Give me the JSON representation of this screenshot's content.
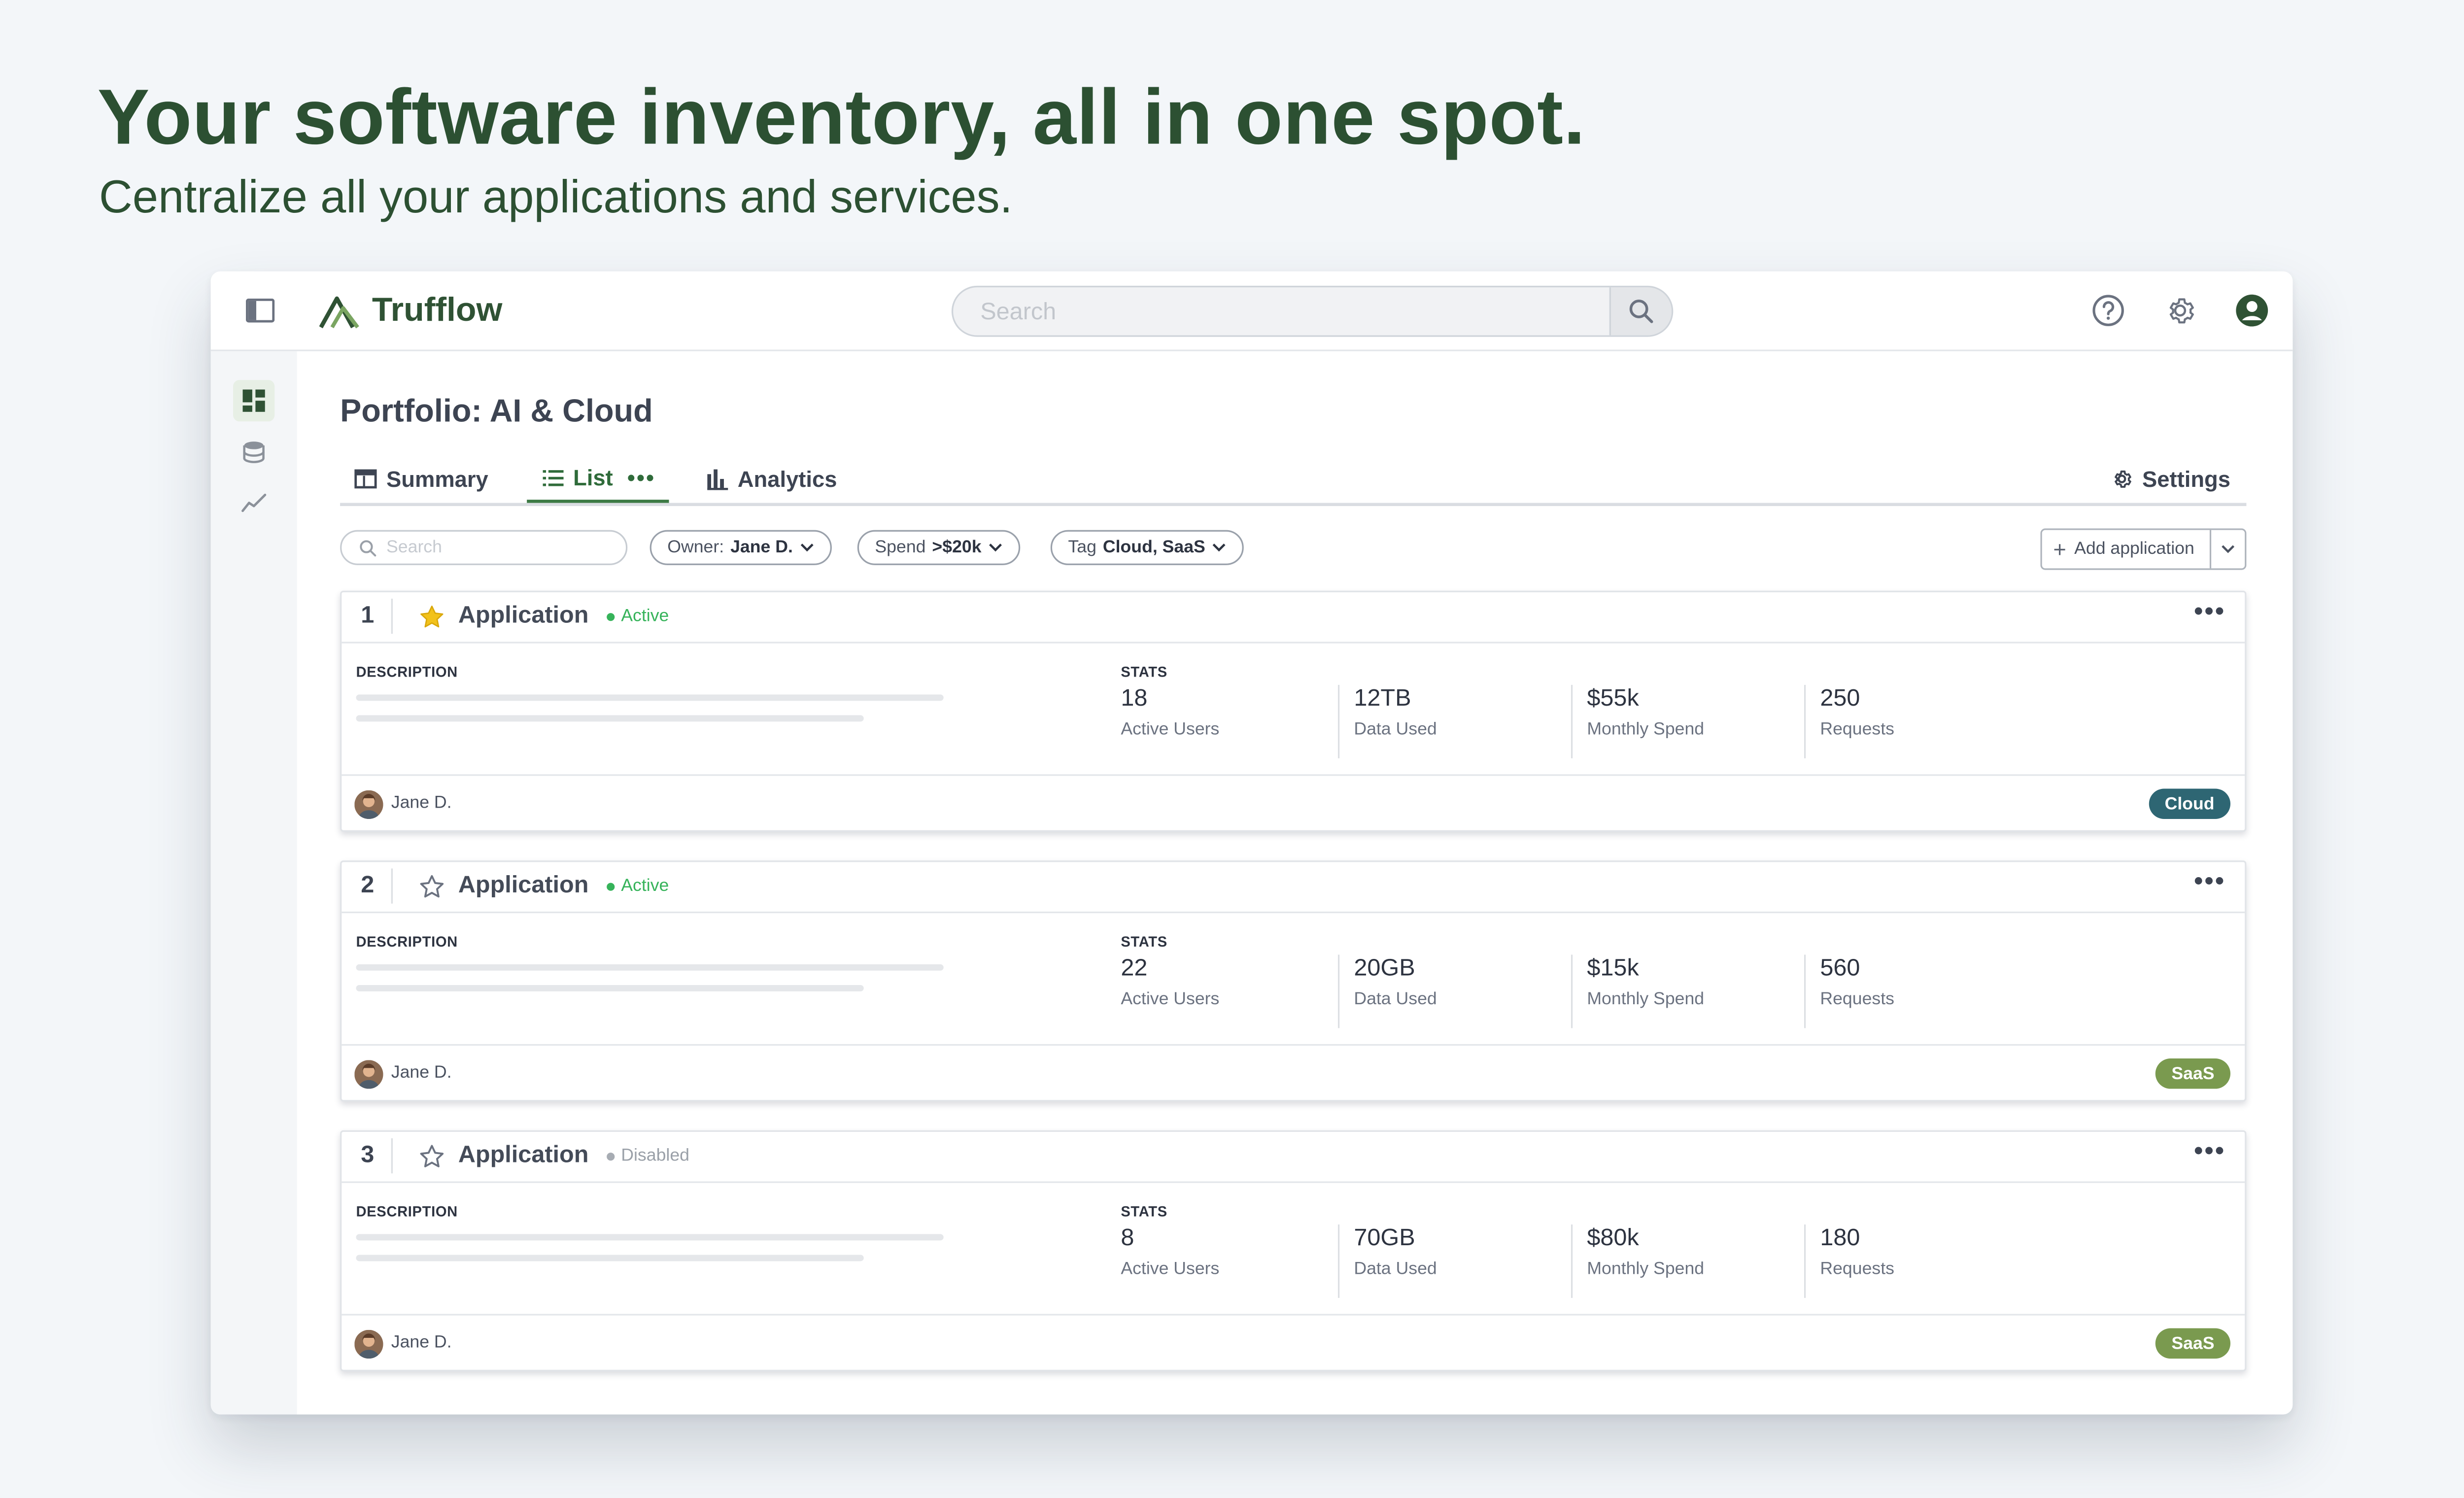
{
  "hero": {
    "title": "Your software inventory, all in one spot.",
    "subtitle": "Centralize all your applications and services."
  },
  "app": {
    "name": "Trufflow",
    "search_placeholder": "Search"
  },
  "icons": {
    "sidebar_toggle": "sidebar-toggle-icon",
    "search": "search-icon",
    "help": "help-icon",
    "settings": "gear-icon",
    "account": "user-circle-icon",
    "rail": [
      "dashboard-icon",
      "database-icon",
      "trend-chart-icon"
    ]
  },
  "page": {
    "title": "Portfolio: AI & Cloud",
    "tabs": [
      {
        "label": "Summary",
        "icon": "table-icon",
        "active": false
      },
      {
        "label": "List",
        "icon": "list-icon",
        "active": true,
        "more": "•••"
      },
      {
        "label": "Analytics",
        "icon": "bar-chart-icon",
        "active": false
      }
    ],
    "settings_label": "Settings"
  },
  "filters": {
    "search_placeholder": "Search",
    "owner": {
      "label": "Owner:",
      "value": "Jane D."
    },
    "spend": {
      "label": "Spend",
      "value": ">$20k"
    },
    "tag": {
      "label": "Tag",
      "value": "Cloud, SaaS"
    },
    "add_button": "Add application"
  },
  "labels": {
    "description": "DESCRIPTION",
    "stats": "STATS"
  },
  "cards": [
    {
      "number": "1",
      "starred": true,
      "title": "Application",
      "status": "Active",
      "stats": [
        {
          "value": "18",
          "label": "Active Users"
        },
        {
          "value": "12TB",
          "label": "Data Used"
        },
        {
          "value": "$55k",
          "label": "Monthly Spend"
        },
        {
          "value": "250",
          "label": "Requests"
        }
      ],
      "owner": "Jane D.",
      "tag": "Cloud",
      "tag_color": "#2e6673"
    },
    {
      "number": "2",
      "starred": false,
      "title": "Application",
      "status": "Active",
      "stats": [
        {
          "value": "22",
          "label": "Active Users"
        },
        {
          "value": "20GB",
          "label": "Data Used"
        },
        {
          "value": "$15k",
          "label": "Monthly Spend"
        },
        {
          "value": "560",
          "label": "Requests"
        }
      ],
      "owner": "Jane D.",
      "tag": "SaaS",
      "tag_color": "#7a9a4f"
    },
    {
      "number": "3",
      "starred": false,
      "title": "Application",
      "status": "Disabled",
      "stats": [
        {
          "value": "8",
          "label": "Active Users"
        },
        {
          "value": "70GB",
          "label": "Data Used"
        },
        {
          "value": "$80k",
          "label": "Monthly Spend"
        },
        {
          "value": "180",
          "label": "Requests"
        }
      ],
      "owner": "Jane D.",
      "tag": "SaaS",
      "tag_color": "#7a9a4f"
    }
  ],
  "colors": {
    "brand": "#2f5234",
    "active_status": "#36b35a",
    "disabled_status": "#9aa0a8",
    "star": "#f2c21b"
  }
}
